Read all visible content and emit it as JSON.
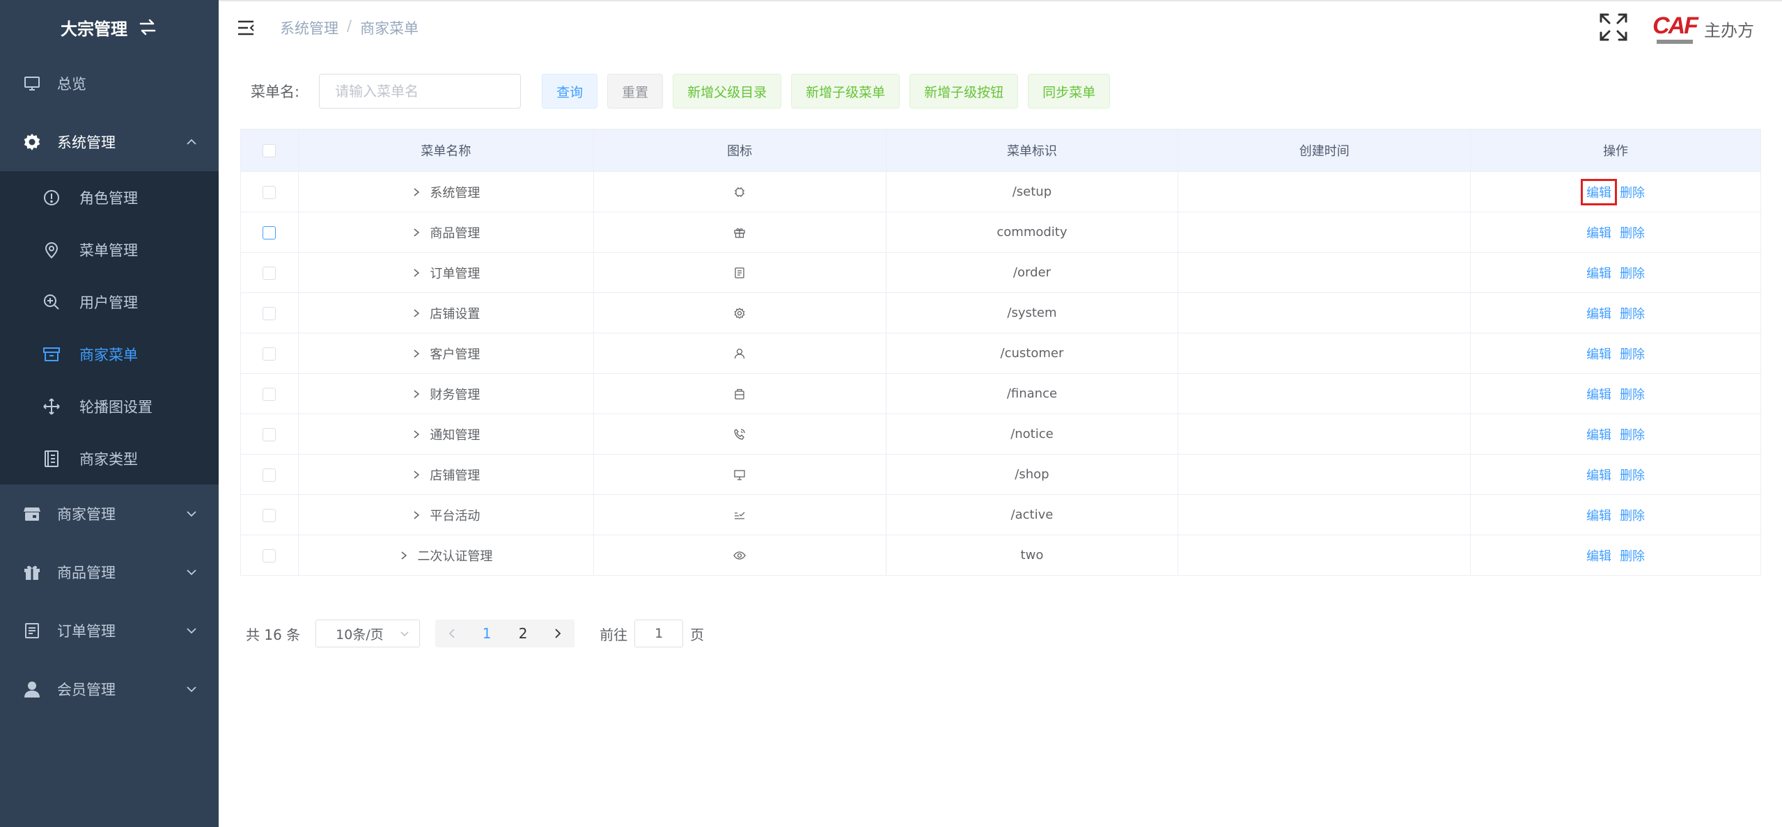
{
  "sidebar": {
    "brand": "大宗管理",
    "items": [
      {
        "label": "总览",
        "icon": "monitor-icon"
      },
      {
        "label": "系统管理",
        "icon": "gear-icon",
        "open": true,
        "children": [
          {
            "label": "角色管理",
            "icon": "info-circle-icon"
          },
          {
            "label": "菜单管理",
            "icon": "location-pin-icon"
          },
          {
            "label": "用户管理",
            "icon": "zoom-in-icon"
          },
          {
            "label": "商家菜单",
            "icon": "box-icon",
            "active": true
          },
          {
            "label": "轮播图设置",
            "icon": "move-icon"
          },
          {
            "label": "商家类型",
            "icon": "notebook-icon"
          }
        ]
      },
      {
        "label": "商家管理",
        "icon": "shop-icon"
      },
      {
        "label": "商品管理",
        "icon": "gift-icon"
      },
      {
        "label": "订单管理",
        "icon": "order-icon"
      },
      {
        "label": "会员管理",
        "icon": "user-icon"
      }
    ],
    "active_color": "#409eff",
    "background": "#304156"
  },
  "header": {
    "breadcrumb": [
      "系统管理",
      "商家菜单"
    ],
    "separator": "/",
    "logo_text": "CAF",
    "user_name": "主办方"
  },
  "search": {
    "label": "菜单名:",
    "placeholder": "请输入菜单名",
    "value": "",
    "buttons": {
      "query": "查询",
      "reset": "重置",
      "add_parent": "新增父级目录",
      "add_child_menu": "新增子级菜单",
      "add_child_button": "新增子级按钮",
      "sync_menu": "同步菜单"
    }
  },
  "table": {
    "columns": [
      "菜单名称",
      "图标",
      "菜单标识",
      "创建时间",
      "操作"
    ],
    "edit_label": "编辑",
    "delete_label": "删除",
    "rows": [
      {
        "name": "系统管理",
        "icon": "chip-icon",
        "path": "/setup",
        "created": ""
      },
      {
        "name": "商品管理",
        "icon": "gift-icon",
        "path": "commodity",
        "created": ""
      },
      {
        "name": "订单管理",
        "icon": "document-icon",
        "path": "/order",
        "created": ""
      },
      {
        "name": "店铺设置",
        "icon": "gear-outline-icon",
        "path": "/system",
        "created": ""
      },
      {
        "name": "客户管理",
        "icon": "user-outline-icon",
        "path": "/customer",
        "created": ""
      },
      {
        "name": "财务管理",
        "icon": "briefcase-icon",
        "path": "/finance",
        "created": ""
      },
      {
        "name": "通知管理",
        "icon": "phone-icon",
        "path": "/notice",
        "created": ""
      },
      {
        "name": "店铺管理",
        "icon": "monitor-outline-icon",
        "path": "/shop",
        "created": ""
      },
      {
        "name": "平台活动",
        "icon": "checklist-icon",
        "path": "/active",
        "created": ""
      },
      {
        "name": "二次认证管理",
        "icon": "eye-icon",
        "path": "two",
        "created": ""
      }
    ]
  },
  "pagination": {
    "total": "共 16 条",
    "page_size": "10条/页",
    "pages": [
      "1",
      "2"
    ],
    "current": "1",
    "goto_prefix": "前往",
    "goto_value": "1",
    "goto_suffix": "页"
  }
}
